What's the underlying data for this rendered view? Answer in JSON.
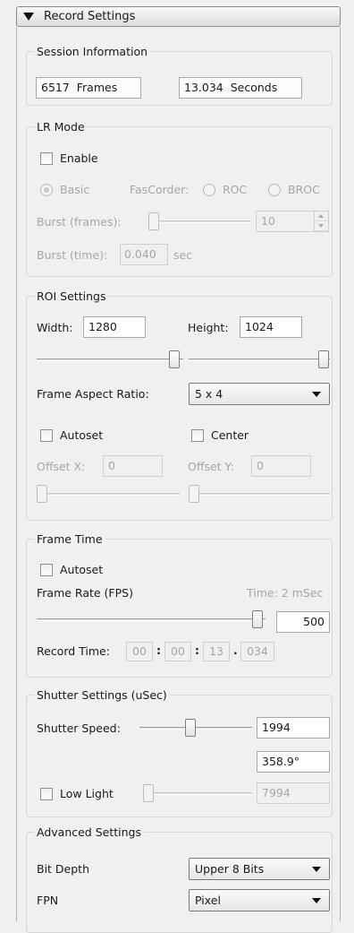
{
  "header": {
    "title": "Record Settings"
  },
  "session": {
    "legend": "Session Information",
    "frames_value": "6517",
    "frames_unit": "Frames",
    "seconds_value": "13.034",
    "seconds_unit": "Seconds"
  },
  "lr_mode": {
    "legend": "LR Mode",
    "enable_label": "Enable",
    "basic_label": "Basic",
    "fascorder_label": "FasCorder:",
    "roc_label": "ROC",
    "broc_label": "BROC",
    "burst_frames_label": "Burst (frames):",
    "burst_frames_value": "10",
    "burst_time_label": "Burst (time):",
    "burst_time_value": "0.040",
    "burst_time_unit": "sec"
  },
  "roi": {
    "legend": "ROI Settings",
    "width_label": "Width:",
    "width_value": "1280",
    "height_label": "Height:",
    "height_value": "1024",
    "aspect_label": "Frame Aspect Ratio:",
    "aspect_value": "5 x 4",
    "autoset_label": "Autoset",
    "center_label": "Center",
    "offset_x_label": "Offset X:",
    "offset_x_value": "0",
    "offset_y_label": "Offset Y:",
    "offset_y_value": "0"
  },
  "frame_time": {
    "legend": "Frame  Time",
    "autoset_label": "Autoset",
    "rate_label": "Frame Rate (FPS)",
    "time_label": "Time: 2 mSec",
    "rate_value": "500",
    "record_time_label": "Record Time:",
    "record_time": [
      "00",
      "00",
      "13",
      "034"
    ],
    "sep_colon": ":",
    "sep_dot": "."
  },
  "shutter": {
    "legend": "Shutter Settings (uSec)",
    "speed_label": "Shutter Speed:",
    "speed_value": "1994",
    "angle_value": "358.9°",
    "low_light_label": "Low Light",
    "low_light_value": "7994"
  },
  "advanced": {
    "legend": "Advanced Settings",
    "bit_depth_label": "Bit Depth",
    "bit_depth_value": "Upper 8 Bits",
    "fpn_label": "FPN",
    "fpn_value": "Pixel"
  }
}
